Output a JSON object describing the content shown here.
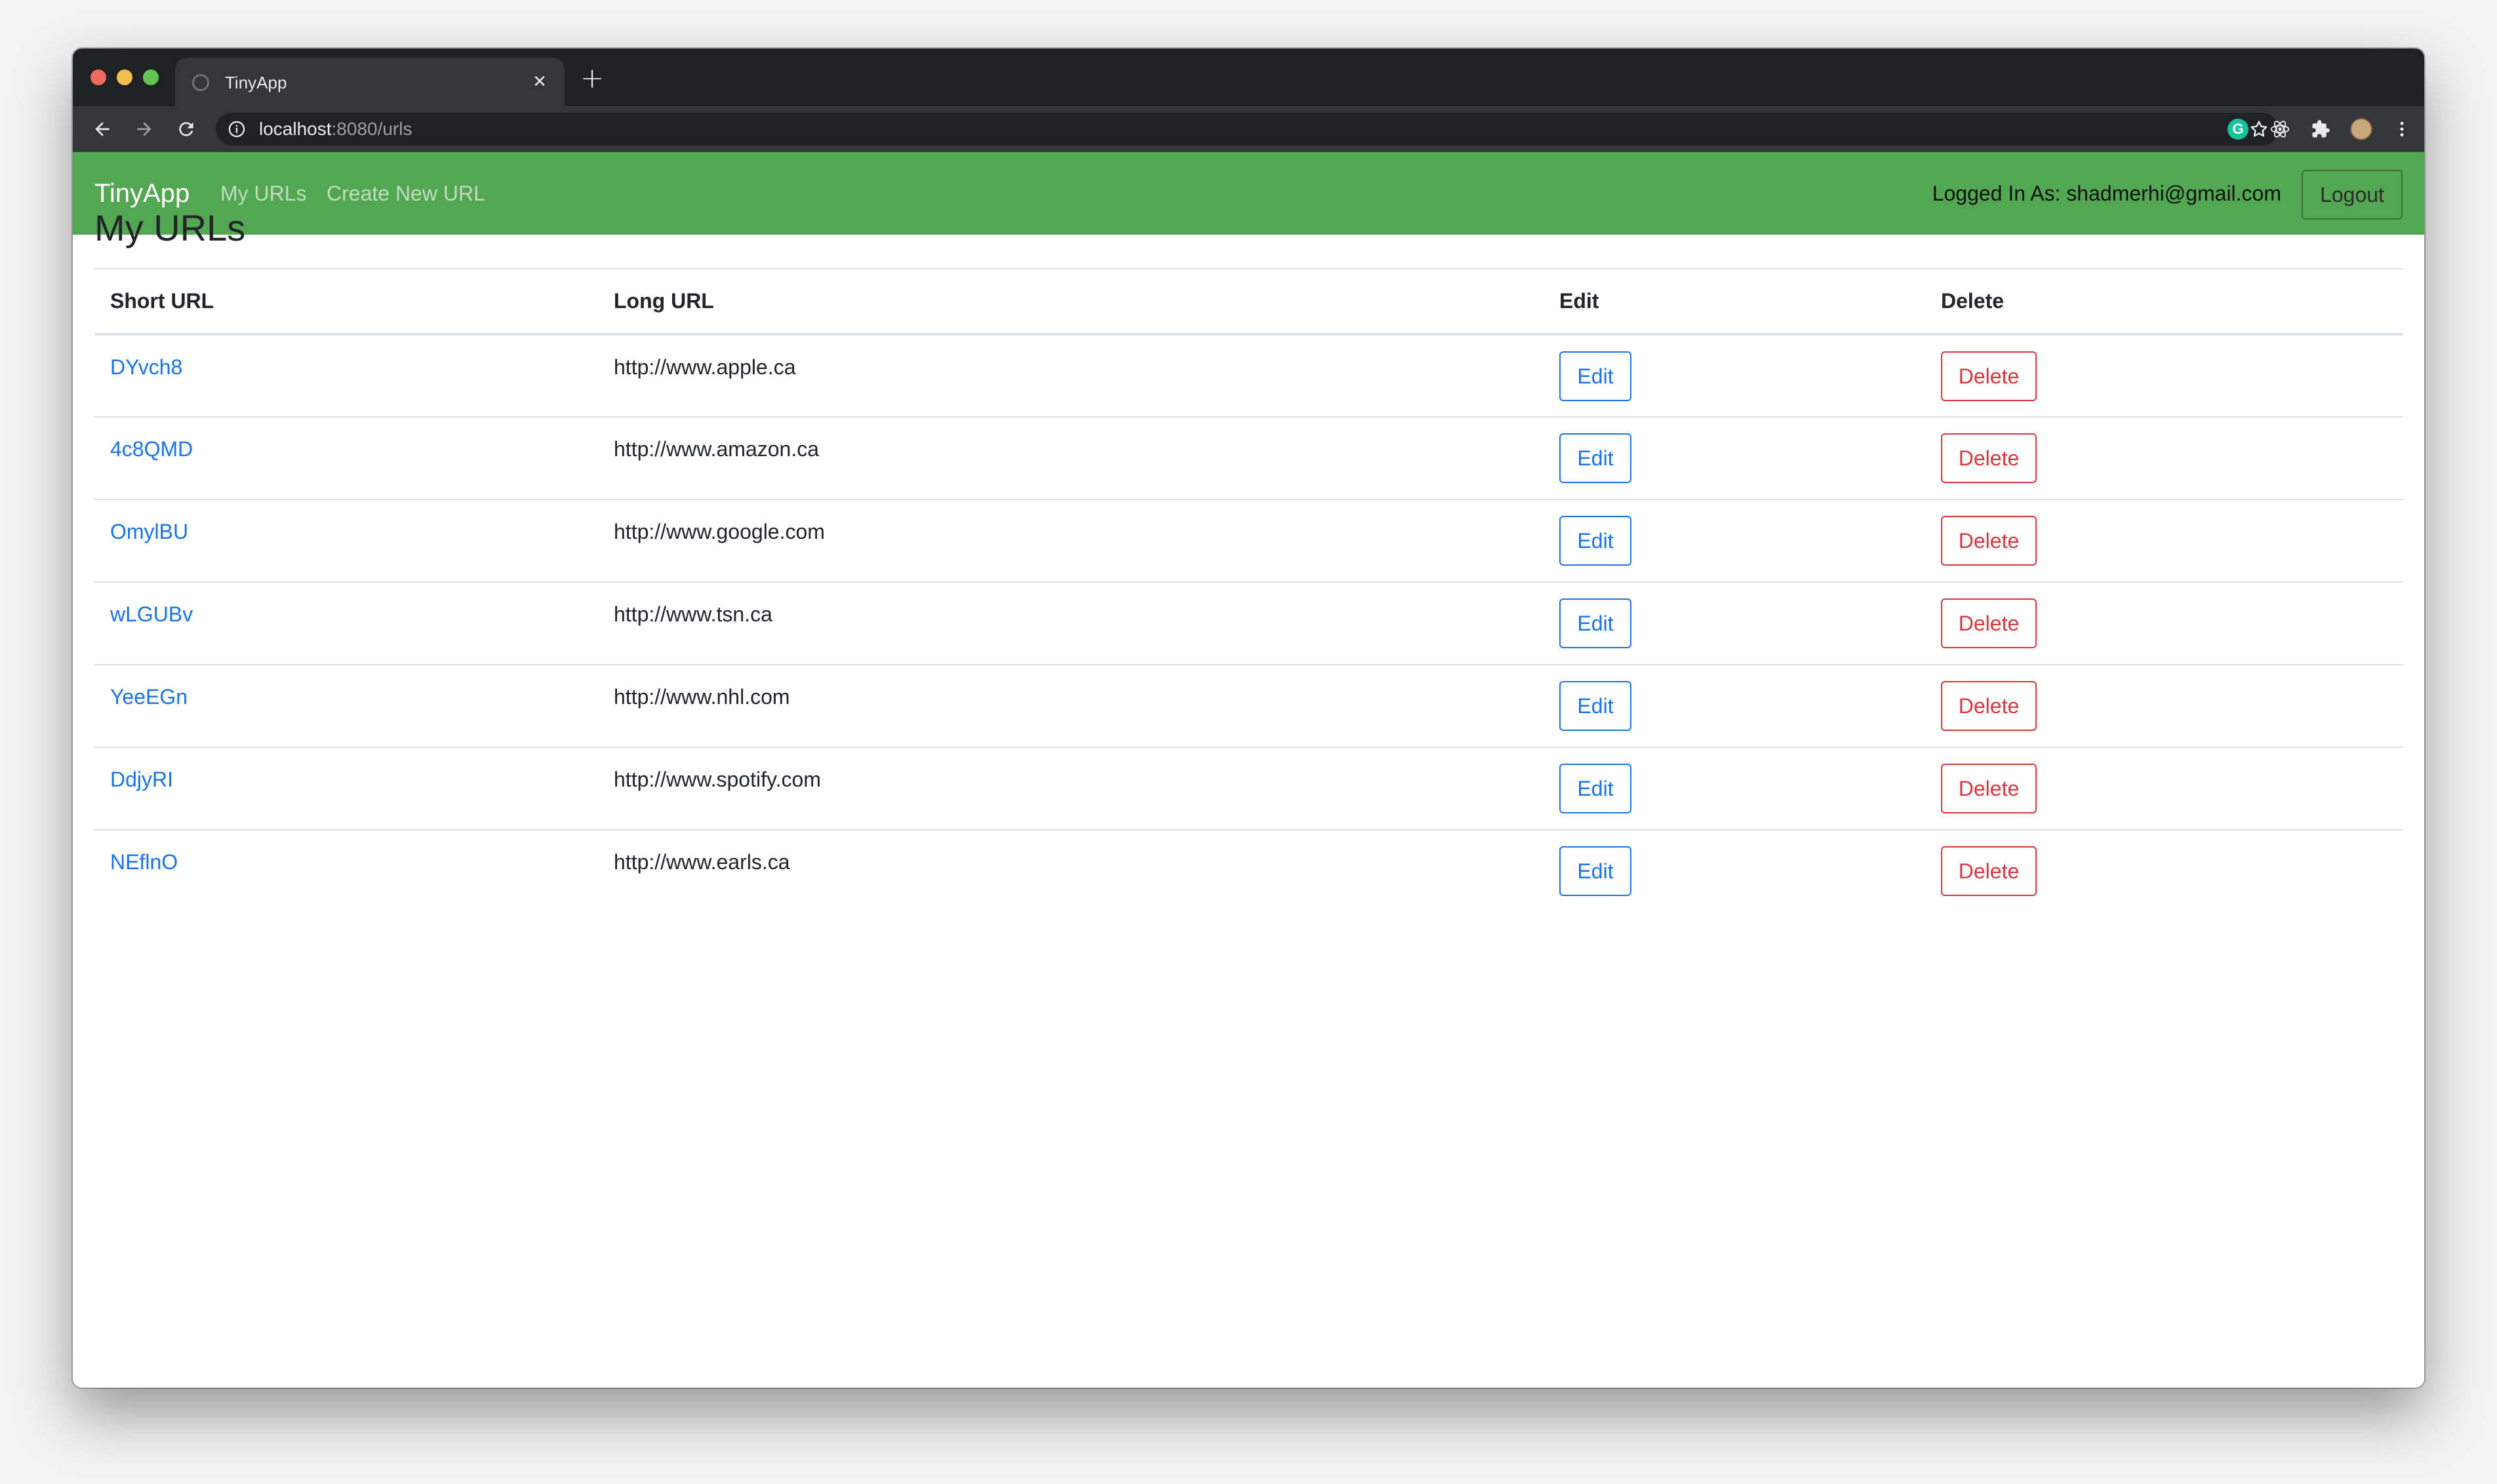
{
  "browser": {
    "tab_title": "TinyApp",
    "url_host": "localhost",
    "url_path": ":8080/urls"
  },
  "navbar": {
    "brand": "TinyApp",
    "links": [
      {
        "label": "My URLs"
      },
      {
        "label": "Create New URL"
      }
    ],
    "logged_in_text": "Logged In As: shadmerhi@gmail.com",
    "logout_label": "Logout"
  },
  "main": {
    "title": "My URLs",
    "columns": [
      "Short URL",
      "Long URL",
      "Edit",
      "Delete"
    ],
    "edit_label": "Edit",
    "delete_label": "Delete",
    "rows": [
      {
        "short": "DYvch8",
        "long": "http://www.apple.ca"
      },
      {
        "short": "4c8QMD",
        "long": "http://www.amazon.ca"
      },
      {
        "short": "OmylBU",
        "long": "http://www.google.com"
      },
      {
        "short": "wLGUBv",
        "long": "http://www.tsn.ca"
      },
      {
        "short": "YeeEGn",
        "long": "http://www.nhl.com"
      },
      {
        "short": "DdjyRI",
        "long": "http://www.spotify.com"
      },
      {
        "short": "NEflnO",
        "long": "http://www.earls.ca"
      }
    ]
  },
  "colors": {
    "navbar_green": "#53a752",
    "link_blue": "#1a73e8",
    "delete_red": "#d9363e"
  }
}
